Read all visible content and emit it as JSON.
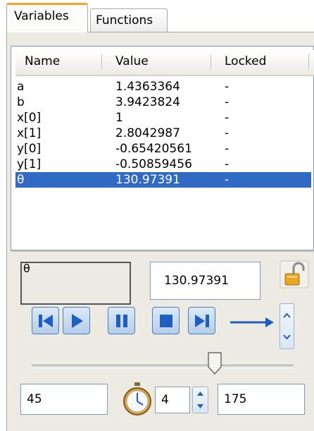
{
  "tabs": {
    "variables": "Variables",
    "functions": "Functions"
  },
  "table": {
    "headers": [
      "Name",
      "Value",
      "Locked"
    ],
    "rows": [
      {
        "name": "a",
        "value": "1.4363364",
        "locked": "-"
      },
      {
        "name": "b",
        "value": "3.9423824",
        "locked": "-"
      },
      {
        "name": "x[0]",
        "value": "1",
        "locked": "-"
      },
      {
        "name": "x[1]",
        "value": "2.8042987",
        "locked": "-"
      },
      {
        "name": "y[0]",
        "value": "-0.65420561",
        "locked": "-"
      },
      {
        "name": "y[1]",
        "value": "-0.50859456",
        "locked": "-"
      },
      {
        "name": "θ",
        "value": "130.97391",
        "locked": "-"
      }
    ],
    "selected_row": 6
  },
  "editor": {
    "name": "θ",
    "value": "130.97391"
  },
  "animation": {
    "slider_level_percent": 70
  },
  "bottom": {
    "min": "45",
    "step": "4",
    "max": "175"
  },
  "colors": {
    "selection": "#316ac5",
    "accent_tab": "#f3a42b",
    "media_icon": "#1f5fbf"
  },
  "icons": {
    "lock": "open-padlock-icon",
    "media": [
      "skip-to-start-icon",
      "play-icon",
      "pause-icon",
      "stop-icon",
      "skip-to-end-icon"
    ],
    "direction": "right-arrow-icon",
    "timer": "stopwatch-icon"
  }
}
